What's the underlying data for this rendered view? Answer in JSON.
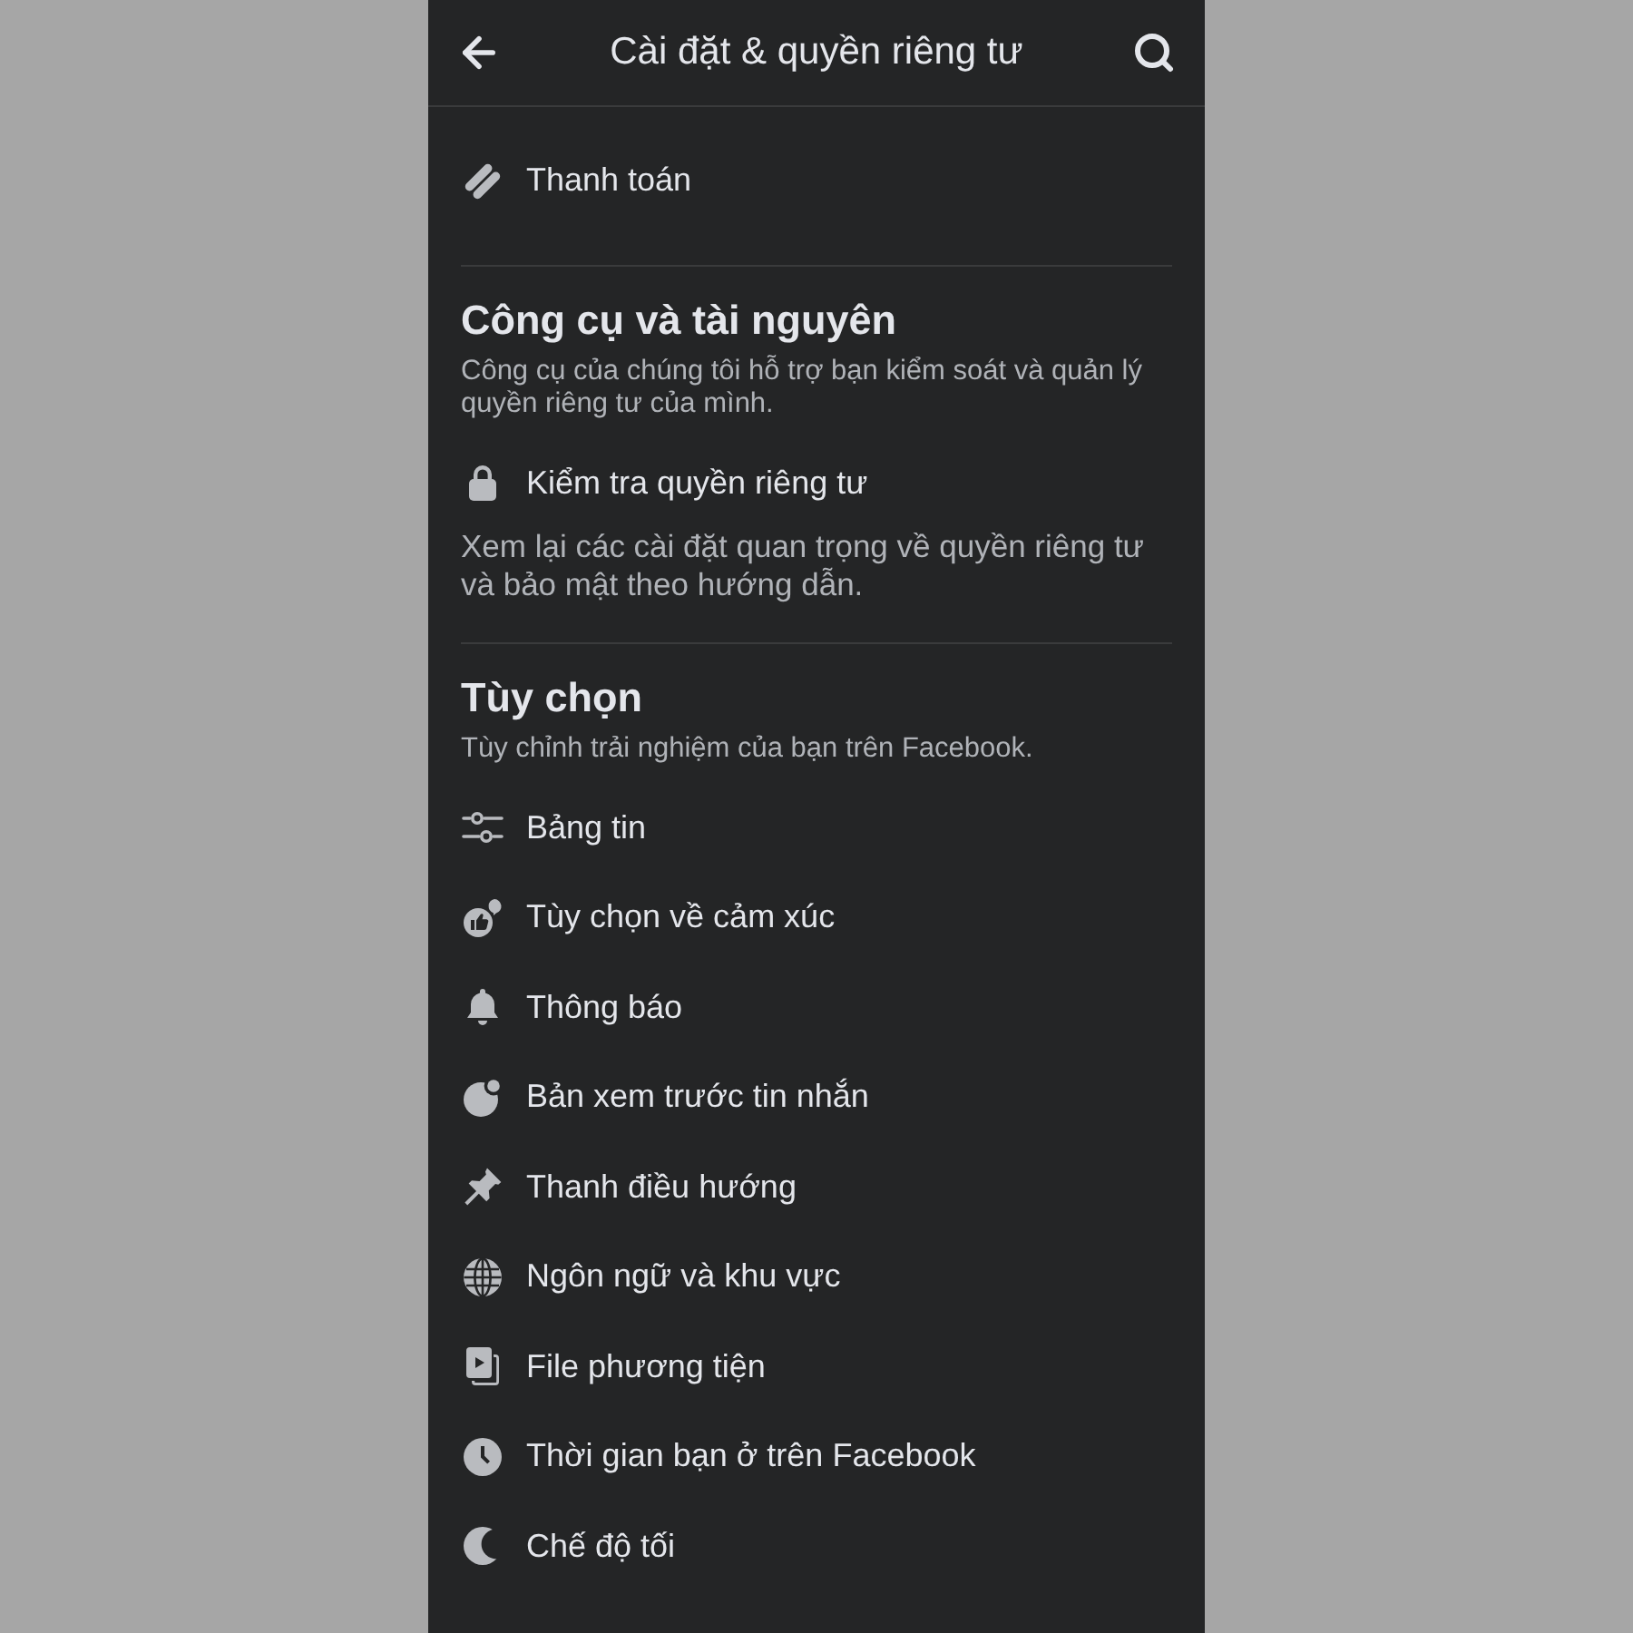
{
  "header": {
    "title": "Cài đặt & quyền riêng tư"
  },
  "sections": [
    {
      "items": [
        {
          "label": "Thanh toán"
        }
      ]
    },
    {
      "title": "Công cụ và tài nguyên",
      "description": "Công cụ của chúng tôi hỗ trợ bạn kiểm soát và quản lý quyền riêng tư của mình.",
      "items": [
        {
          "label": "Kiểm tra quyền riêng tư",
          "description": "Xem lại các cài đặt quan trọng về quyền riêng tư và bảo mật theo hướng dẫn."
        }
      ]
    },
    {
      "title": "Tùy chọn",
      "description": "Tùy chỉnh trải nghiệm của bạn trên Facebook.",
      "items": [
        {
          "label": "Bảng tin"
        },
        {
          "label": "Tùy chọn về cảm xúc"
        },
        {
          "label": "Thông báo"
        },
        {
          "label": "Bản xem trước tin nhắn"
        },
        {
          "label": "Thanh điều hướng"
        },
        {
          "label": "Ngôn ngữ và khu vực"
        },
        {
          "label": "File phương tiện"
        },
        {
          "label": "Thời gian bạn ở trên Facebook"
        },
        {
          "label": "Chế độ tối"
        }
      ]
    }
  ]
}
